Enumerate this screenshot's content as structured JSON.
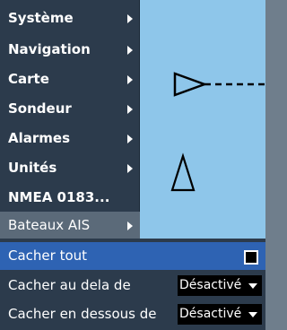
{
  "menu": {
    "items": [
      {
        "label": "Système",
        "has_submenu": true
      },
      {
        "label": "Navigation",
        "has_submenu": true
      },
      {
        "label": "Carte",
        "has_submenu": true
      },
      {
        "label": "Sondeur",
        "has_submenu": true
      },
      {
        "label": "Alarmes",
        "has_submenu": true
      },
      {
        "label": "Unités",
        "has_submenu": true
      },
      {
        "label": "NMEA 0183...",
        "has_submenu": false
      },
      {
        "label": "Bateaux AIS",
        "has_submenu": true,
        "selected": true
      }
    ]
  },
  "submenu": {
    "hide_all": {
      "label": "Cacher tout",
      "checked": false
    },
    "hide_beyond": {
      "label": "Cacher au dela de",
      "value": "Désactivé"
    },
    "hide_below": {
      "label": "Cacher en dessous de",
      "value": "Désactivé"
    }
  },
  "colors": {
    "menu_bg": "#2c3b4c",
    "selected_bg": "#5b6a79",
    "highlight_bg": "#2e63b3",
    "chart_water": "#8ec6ea"
  },
  "icons": [
    "chevron-right-icon",
    "vessel-triangle-icon",
    "heading-line-icon",
    "checkbox-icon",
    "dropdown-arrow-icon"
  ]
}
